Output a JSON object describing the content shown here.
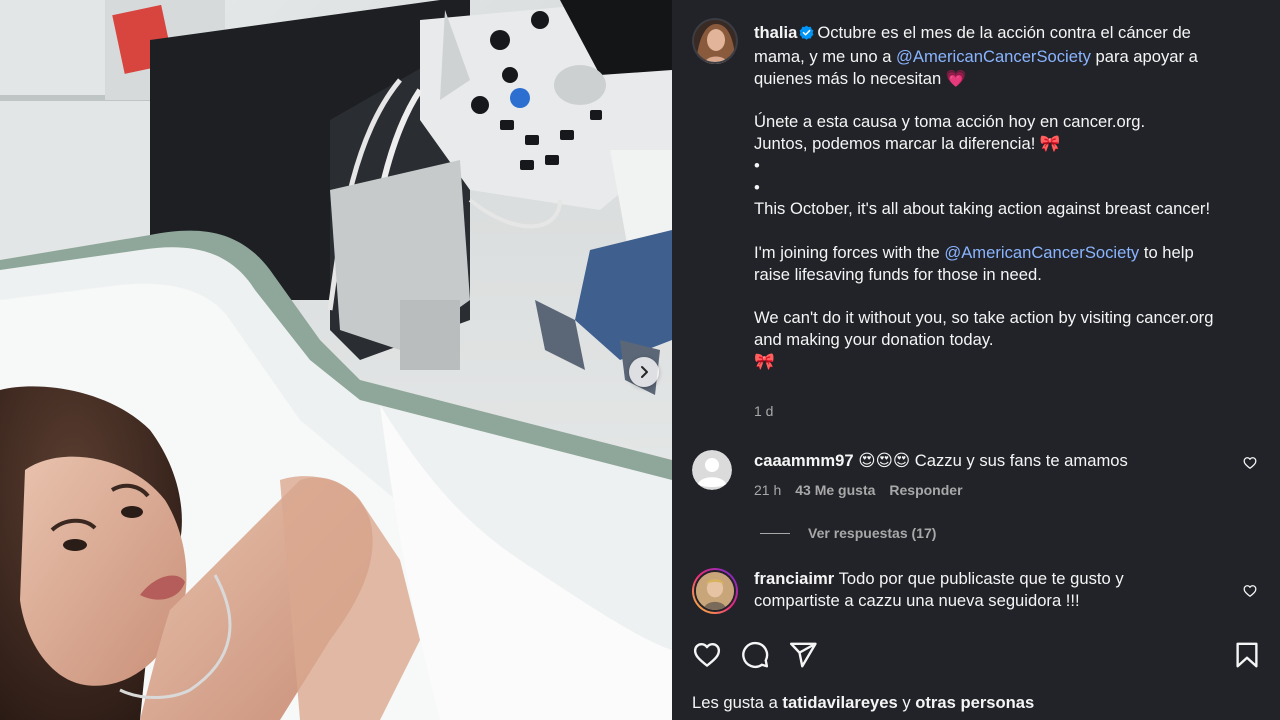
{
  "post": {
    "username": "thalia",
    "caption_lines": [
      {
        "before": "Octubre es el mes de la acción contra el cáncer de mama, y me uno a ",
        "mention": "@AmericanCancerSociety",
        "after": " para apoyar a quienes más lo necesitan 💗"
      },
      {
        "gap": true
      },
      {
        "text": "Únete a esta causa y toma acción hoy en cancer.org."
      },
      {
        "text": "Juntos, podemos marcar la diferencia! 🎀"
      },
      {
        "text": "•"
      },
      {
        "text": "•"
      },
      {
        "text": "This October, it's all about taking action against breast cancer!"
      },
      {
        "gap": true
      },
      {
        "before": "I'm joining forces with the ",
        "mention": "@AmericanCancerSociety",
        "after": " to help raise lifesaving funds for those in need."
      },
      {
        "gap": true
      },
      {
        "text": "We can't do it without you, so take action by visiting cancer.org and making your donation today."
      },
      {
        "text": "🎀"
      }
    ],
    "time": "1 d"
  },
  "comments": [
    {
      "username": "caaammm97",
      "text": "😍😍😍 Cazzu y sus fans te amamos",
      "time": "21 h",
      "likes": "43 Me gusta",
      "reply": "Responder"
    },
    {
      "username": "franciaimr",
      "text": "Todo por que publicaste que te gusto y compartiste a cazzu una nueva seguidora !!!"
    }
  ],
  "view_replies": "Ver respuestas (17)",
  "likes_line": {
    "prefix": "Les gusta a ",
    "user": "tatidavilareyes",
    "middle": " y ",
    "rest": "otras personas"
  },
  "colors": {
    "panel_bg": "#212328",
    "mention": "#8ab4ff",
    "verified": "#0095f6",
    "muted": "#a8a8a8"
  },
  "icons": [
    "verified-badge-icon",
    "heart-icon",
    "comment-icon",
    "share-icon",
    "bookmark-icon",
    "chevron-right-icon"
  ]
}
